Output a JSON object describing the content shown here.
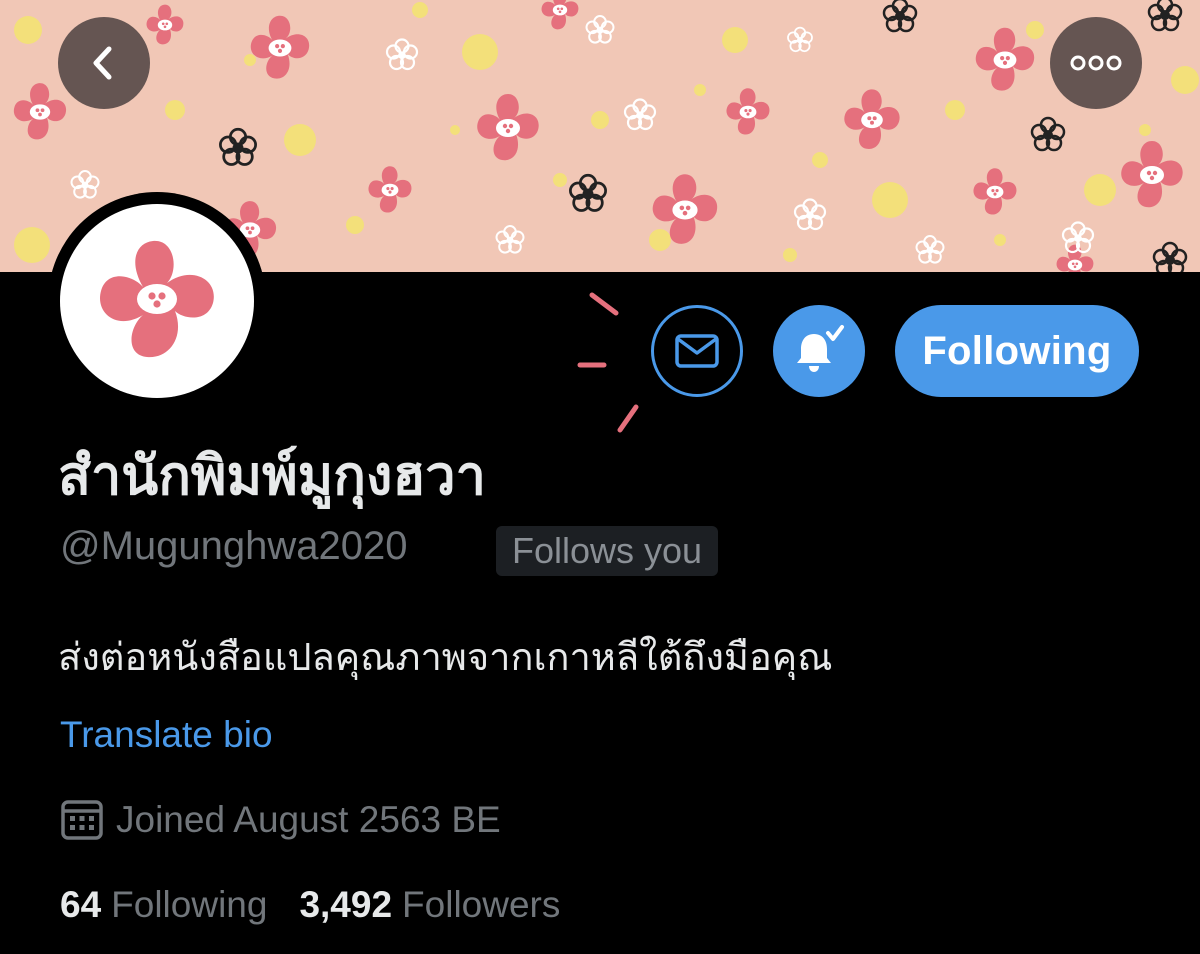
{
  "header": {
    "back_icon": "chevron-left-icon",
    "more_icon": "ellipsis-icon"
  },
  "actions": {
    "message_icon": "envelope-icon",
    "notify_icon": "bell-check-icon",
    "following_label": "Following"
  },
  "profile": {
    "display_name": "สำนักพิมพ์มูกุงฮวา",
    "handle": "@Mugunghwa2020",
    "follows_you_badge": "Follows you",
    "bio": "ส่งต่อหนังสือแปลคุณภาพจากเกาหลีใต้ถึงมือคุณ",
    "translate_link": "Translate bio",
    "joined": "Joined August 2563 BE",
    "joined_icon": "calendar-icon",
    "following_count": "64",
    "following_label": "Following",
    "followers_count": "3,492",
    "followers_label": "Followers"
  },
  "colors": {
    "accent": "#4a99e9",
    "background": "#000000",
    "banner_bg": "#f1c7b6",
    "flower_pink": "#e5707d",
    "muted_text": "#71767b"
  }
}
